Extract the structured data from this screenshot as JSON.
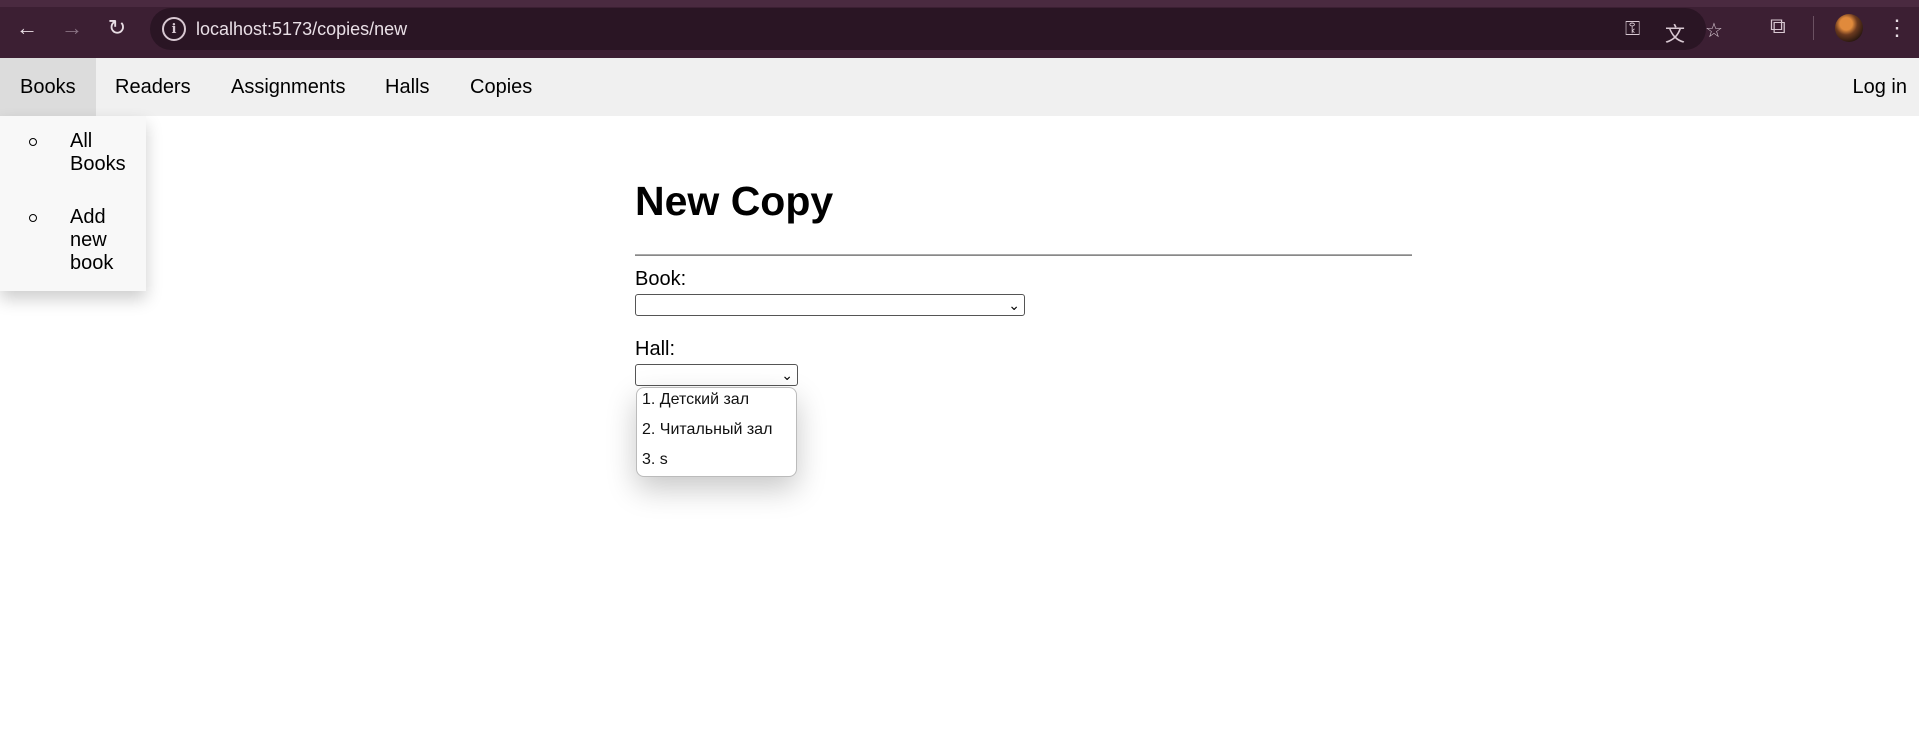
{
  "browser": {
    "url": "localhost:5173/copies/new",
    "icons": [
      "back-icon",
      "forward-icon",
      "reload-icon",
      "site-info-icon",
      "password-key-icon",
      "translate-icon",
      "bookmark-star-icon",
      "extensions-icon",
      "profile-avatar",
      "menu-kebab-icon"
    ]
  },
  "navbar": {
    "items": [
      {
        "label": "Books"
      },
      {
        "label": "Readers"
      },
      {
        "label": "Assignments"
      },
      {
        "label": "Halls"
      },
      {
        "label": "Copies"
      }
    ],
    "login_label": "Log in"
  },
  "books_menu": {
    "items": [
      {
        "label": "All Books"
      },
      {
        "label": "Add new book"
      }
    ]
  },
  "form": {
    "title": "New Copy",
    "book_label": "Book:",
    "book_value": "",
    "hall_label": "Hall:",
    "hall_value": "",
    "hall_options": [
      "1. Детский зал",
      "2. Читальный зал",
      "3. s"
    ]
  }
}
